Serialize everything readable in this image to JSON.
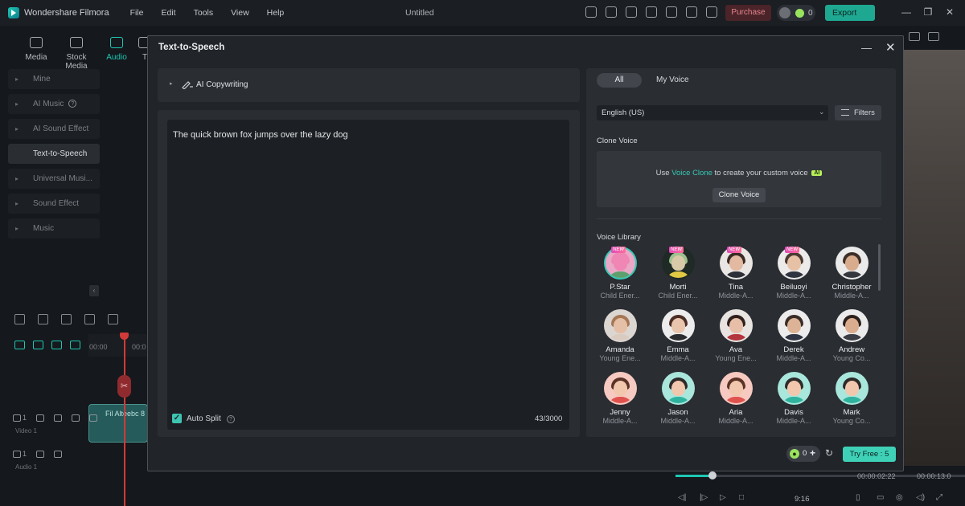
{
  "app": {
    "name": "Wondershare Filmora",
    "menu": [
      "File",
      "Edit",
      "Tools",
      "View",
      "Help"
    ],
    "doc_title": "Untitled",
    "purchase": "Purchase",
    "credits": "0",
    "export": "Export"
  },
  "media_tabs": [
    "Media",
    "Stock Media",
    "Audio",
    "T"
  ],
  "sidebar": {
    "items": [
      {
        "label": "Mine",
        "help": false,
        "active": false
      },
      {
        "label": "AI Music",
        "help": true,
        "active": false
      },
      {
        "label": "AI Sound Effect",
        "help": true,
        "active": false
      },
      {
        "label": "Text-to-Speech",
        "help": false,
        "active": true
      },
      {
        "label": "Universal Musi...",
        "help": false,
        "active": false
      },
      {
        "label": "Sound Effect",
        "help": false,
        "active": false
      },
      {
        "label": "Music",
        "help": false,
        "active": false
      }
    ]
  },
  "timeline": {
    "ruler_start": "00:00",
    "ruler_next": "00:0",
    "clip_label": "Fil Alteebc 8",
    "video_track": "Video 1",
    "audio_track": "Audio 1",
    "track_num_video": "1",
    "track_num_audio": "1"
  },
  "player": {
    "current_time": "00:00:02:22",
    "total_time": "00:00:13:0",
    "ratio": "9:16"
  },
  "dialog": {
    "title": "Text-to-Speech",
    "copywriting_label": "AI Copywriting",
    "text": "The quick brown fox jumps over the lazy dog",
    "auto_split_label": "Auto Split",
    "auto_split_checked": true,
    "char_count": "43/3000",
    "tabs": {
      "all": "All",
      "my_voice": "My Voice",
      "active": "All"
    },
    "language": "English (US)",
    "filters": "Filters",
    "clone_voice_title": "Clone Voice",
    "clone_text_before": "Use ",
    "clone_link": "Voice Clone",
    "clone_text_after": " to create your custom voice",
    "ai_badge": "AI",
    "clone_button": "Clone Voice",
    "library_title": "Voice Library",
    "credits": "0",
    "try_free": "Try Free : 5"
  },
  "voices": [
    {
      "name": "P.Star",
      "desc": "Child Ener...",
      "new": true,
      "selected": true,
      "bg": "#e9a8c6",
      "skin": "#ef86b3",
      "hair": "#ef86b3",
      "shirt": "#5ea06d"
    },
    {
      "name": "Morti",
      "desc": "Child Ener...",
      "new": true,
      "selected": false,
      "bg": "#1f2a26",
      "skin": "#d8c9a8",
      "hair": "#9fc08f",
      "shirt": "#e2c944"
    },
    {
      "name": "Tina",
      "desc": "Middle-A...",
      "new": true,
      "selected": false,
      "bg": "#e9e6e4",
      "skin": "#e3b9a1",
      "hair": "#3a2a25",
      "shirt": "#2c2f36"
    },
    {
      "name": "Beiluoyi",
      "desc": "Middle-A...",
      "new": true,
      "selected": false,
      "bg": "#ecebea",
      "skin": "#e7c1a5",
      "hair": "#4b3a31",
      "shirt": "#2f3440"
    },
    {
      "name": "Christopher",
      "desc": "Middle-A...",
      "new": false,
      "selected": false,
      "bg": "#eaeaea",
      "skin": "#d9ac8e",
      "hair": "#3d2f28",
      "shirt": "#34373d"
    },
    {
      "name": "Amanda",
      "desc": "Young Ene...",
      "new": false,
      "selected": false,
      "bg": "#dcd6d2",
      "skin": "#e6c0a6",
      "hair": "#a57754",
      "shirt": "#d9cbbf"
    },
    {
      "name": "Emma",
      "desc": "Middle-A...",
      "new": false,
      "selected": false,
      "bg": "#ececec",
      "skin": "#e9c5ad",
      "hair": "#4a2d24",
      "shirt": "#2a2c30"
    },
    {
      "name": "Ava",
      "desc": "Young Ene...",
      "new": false,
      "selected": false,
      "bg": "#e8e4e2",
      "skin": "#e7bfa8",
      "hair": "#2f211d",
      "shirt": "#b3353d"
    },
    {
      "name": "Derek",
      "desc": "Middle-A...",
      "new": false,
      "selected": false,
      "bg": "#ececec",
      "skin": "#dcb396",
      "hair": "#3a2c26",
      "shirt": "#2e3444"
    },
    {
      "name": "Andrew",
      "desc": "Young Co...",
      "new": false,
      "selected": false,
      "bg": "#ebebeb",
      "skin": "#dbad8f",
      "hair": "#2b211c",
      "shirt": "#3b3e44"
    },
    {
      "name": "Jenny",
      "desc": "Middle-A...",
      "new": false,
      "selected": false,
      "bg": "#f6c9c1",
      "skin": "#f1c7ad",
      "hair": "#5a3326",
      "shirt": "#e0524e"
    },
    {
      "name": "Jason",
      "desc": "Middle-A...",
      "new": false,
      "selected": false,
      "bg": "#a9e6dc",
      "skin": "#f1c7ad",
      "hair": "#2f2a2a",
      "shirt": "#2fb39f"
    },
    {
      "name": "Aria",
      "desc": "Middle-A...",
      "new": false,
      "selected": false,
      "bg": "#f6c9c1",
      "skin": "#f1c7ad",
      "hair": "#5a3326",
      "shirt": "#e0524e"
    },
    {
      "name": "Davis",
      "desc": "Middle-A...",
      "new": false,
      "selected": false,
      "bg": "#a9e6dc",
      "skin": "#f1c7ad",
      "hair": "#2f2a2a",
      "shirt": "#2fb39f"
    },
    {
      "name": "Mark",
      "desc": "Young Co...",
      "new": false,
      "selected": false,
      "bg": "#a9e6dc",
      "skin": "#f1c7ad",
      "hair": "#2f2a2a",
      "shirt": "#2fb39f"
    }
  ],
  "icons": {
    "new_badge": "NEW",
    "check": "✓",
    "help": "?",
    "close": "✕",
    "minimize": "—",
    "refresh": "↻",
    "plus": "+",
    "chevron": "⌄",
    "caret": "▸",
    "collapse": "‹"
  },
  "colors": {
    "accent": "#1ec8b4",
    "try_free_bg": "#3fd1b8",
    "purchase_text": "#e7848e",
    "credit_green": "#9ae35e"
  }
}
